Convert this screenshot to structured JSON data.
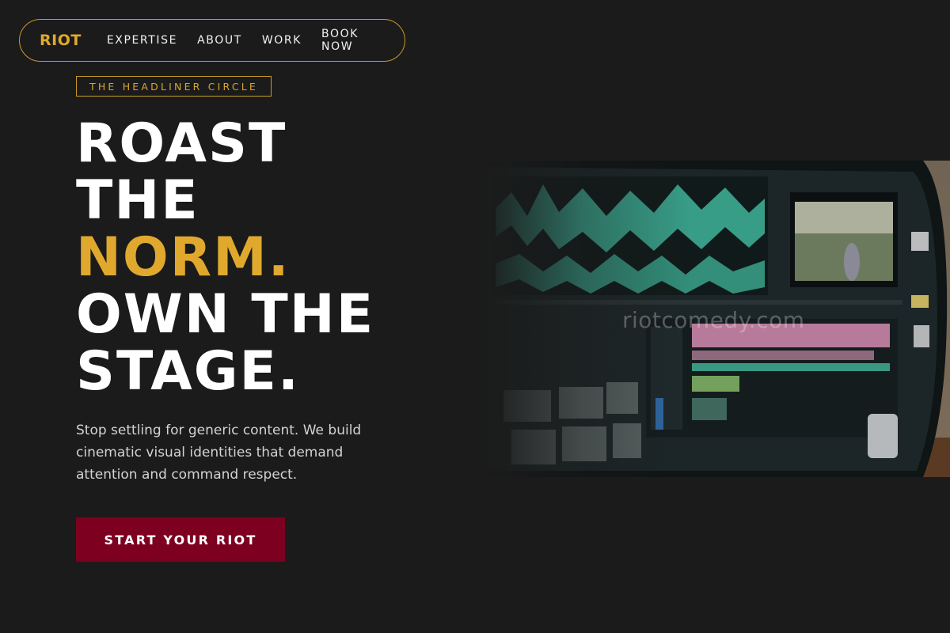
{
  "nav": {
    "logo": "RIOT",
    "links": [
      {
        "label": "EXPERTISE"
      },
      {
        "label": "ABOUT"
      },
      {
        "label": "WORK"
      },
      {
        "label": "BOOK NOW"
      }
    ]
  },
  "hero": {
    "badge": "THE HEADLINER CIRCLE",
    "headline": {
      "line1": "ROAST",
      "line2": "THE",
      "line3": "NORM.",
      "line4": "OWN THE",
      "line5": "STAGE."
    },
    "subtext": "Stop settling for generic content. We build cinematic visual identities that demand attention and command respect.",
    "cta_label": "START YOUR RIOT",
    "image_watermark": "riotcomedy.com"
  },
  "colors": {
    "background": "#1b1b1b",
    "accent_gold": "#e0a92e",
    "cta_red": "#7d0020"
  }
}
